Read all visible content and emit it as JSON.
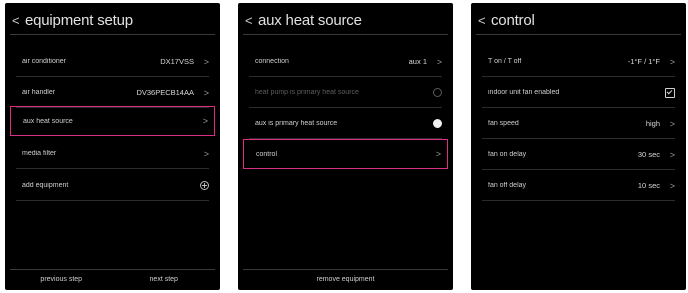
{
  "screens": {
    "equipment": {
      "title": "equipment setup",
      "rows": [
        {
          "label": "air conditioner",
          "value": "DX17VSS"
        },
        {
          "label": "air handler",
          "value": "DV36PECB14AA"
        },
        {
          "label": "aux heat source",
          "value": ""
        },
        {
          "label": "media filter",
          "value": ""
        },
        {
          "label": "add equipment",
          "value": ""
        }
      ],
      "footer": {
        "previous": "previous step",
        "next": "next step"
      }
    },
    "aux": {
      "title": "aux heat source",
      "rows": [
        {
          "label": "connection",
          "value": "aux 1"
        },
        {
          "label": "heat pump is primary heat source",
          "value": ""
        },
        {
          "label": "aux is primary heat source",
          "value": ""
        },
        {
          "label": "control",
          "value": ""
        }
      ],
      "footer": {
        "remove": "remove equipment"
      }
    },
    "control": {
      "title": "control",
      "rows": [
        {
          "label": "T on / T off",
          "value": "-1°F / 1°F"
        },
        {
          "label": "indoor unit fan enabled",
          "value": ""
        },
        {
          "label": "fan speed",
          "value": "high"
        },
        {
          "label": "fan on delay",
          "value": "30 sec"
        },
        {
          "label": "fan off delay",
          "value": "10 sec"
        }
      ]
    }
  },
  "colors": {
    "highlight": "#d92e84",
    "screen_bg": "#000000",
    "text": "#d4d4d4"
  },
  "icons": {
    "back": "chevron-left-icon",
    "chevron": "chevron-right-icon",
    "add": "add-circle-icon",
    "radio": "radio-icon",
    "checkbox": "checkbox-icon"
  }
}
